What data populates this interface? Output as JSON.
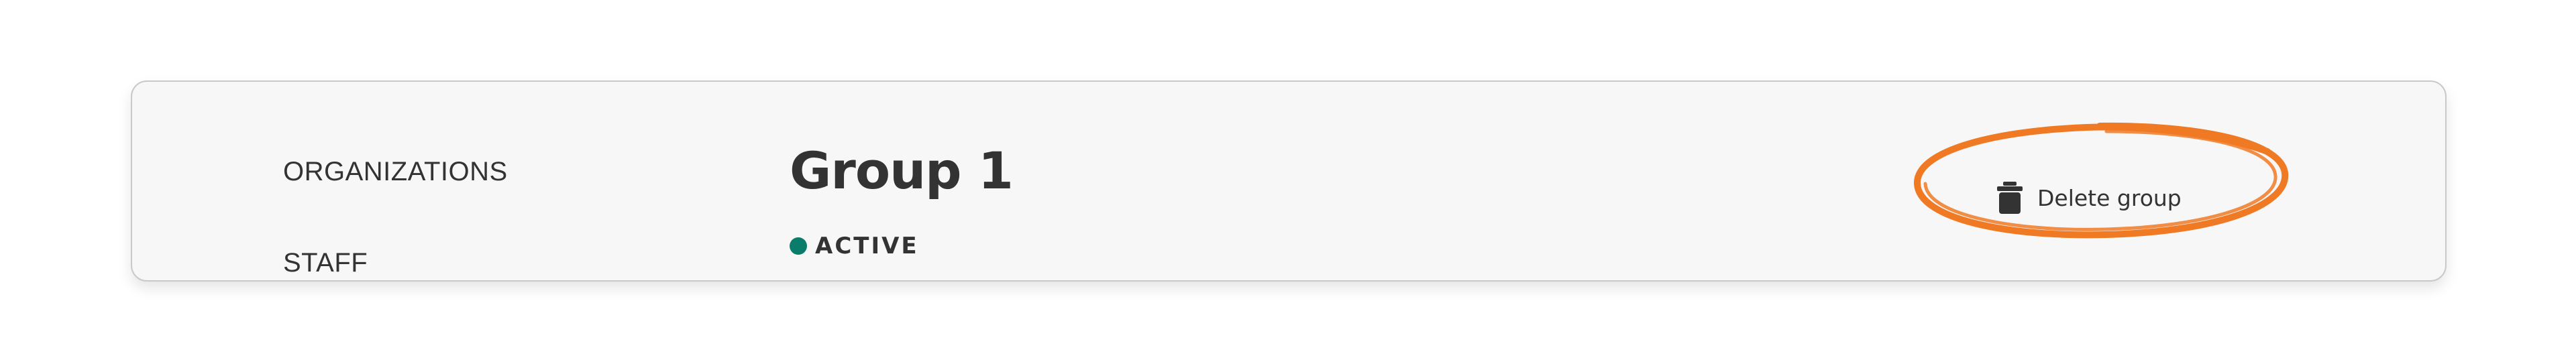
{
  "sidebar": {
    "items": [
      {
        "label": "ORGANIZATIONS"
      },
      {
        "label": "STAFF"
      }
    ]
  },
  "group": {
    "title": "Group 1",
    "status": "ACTIVE",
    "status_color": "#0a7d6a"
  },
  "actions": {
    "delete_label": "Delete group",
    "delete_icon": "trash-icon"
  },
  "annotation": {
    "color": "#f07a24"
  }
}
